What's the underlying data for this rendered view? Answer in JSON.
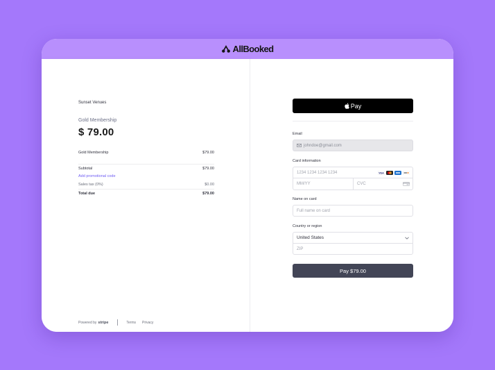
{
  "app": {
    "brand": "AllBooked",
    "logo_icon": "allbooked-logo-icon"
  },
  "summary": {
    "merchant": "Sunset Venues",
    "product_name": "Gold Membership",
    "price": "$ 79.00",
    "line_item": {
      "label": "Gold Membership",
      "amount": "$79.00"
    },
    "subtotal": {
      "label": "Subtotal",
      "amount": "$79.00"
    },
    "promo_link": "Add promotional code",
    "tax": {
      "label": "Sales tax (0%)",
      "amount": "$0.00"
    },
    "total": {
      "label": "Total due",
      "amount": "$79.00"
    }
  },
  "footer": {
    "powered_by": "Powered by",
    "stripe": "stripe",
    "terms": "Terms",
    "privacy": "Privacy"
  },
  "payment": {
    "apple_pay_label": "Pay",
    "email_label": "Email",
    "email_value": "johndoe@gmail.com",
    "card_label": "Card information",
    "card_number_placeholder": "1234 1234 1234 1234",
    "expiry_placeholder": "MM/YY",
    "cvc_placeholder": "CVC",
    "card_brands": [
      "visa",
      "mastercard",
      "amex",
      "discover"
    ],
    "name_label": "Name on card",
    "name_placeholder": "Full name on card",
    "country_label": "Country or region",
    "country_value": "United States",
    "zip_placeholder": "ZIP",
    "pay_button": "Pay $79.00"
  },
  "colors": {
    "background": "#a478fb",
    "titlebar": "#b88ffd",
    "accent_link": "#6e5cf3",
    "pay_button": "#424556"
  }
}
